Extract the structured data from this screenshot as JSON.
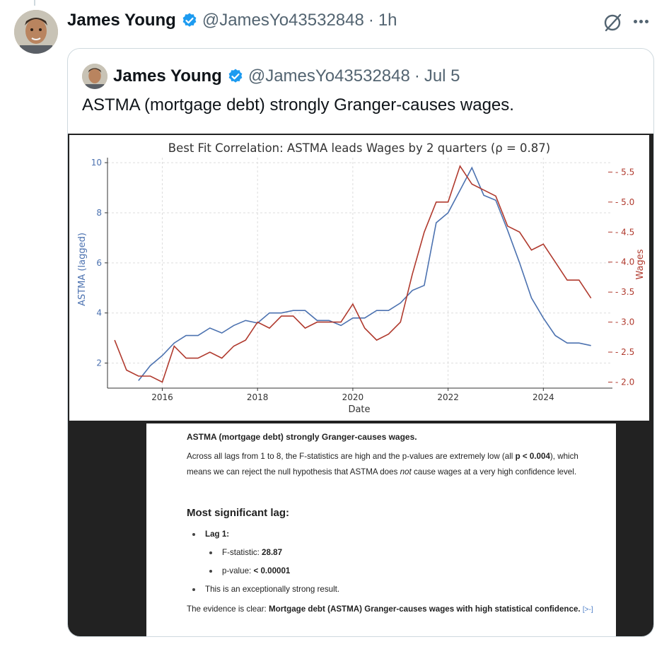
{
  "tweet": {
    "name": "James Young",
    "handle": "@JamesYo43532848",
    "separator": "·",
    "time": "1h"
  },
  "quoted_tweet": {
    "name": "James Young",
    "handle": "@JamesYo43532848",
    "separator": "·",
    "time": "Jul 5",
    "text": "ASTMA (mortgage debt) strongly Granger-causes wages."
  },
  "colors": {
    "verified": "#1d9bf0",
    "astma_series": "#4c72b0",
    "wages_series": "#b03a2e",
    "media_bg": "#222222"
  },
  "icons": {
    "verified": "verified-badge-icon",
    "grok": "grok-icon",
    "more": "more-icon"
  },
  "chart_data": {
    "type": "line",
    "title": "Best Fit Correlation: ASTMA leads Wages by 2 quarters (ρ = 0.87)",
    "xlabel": "Date",
    "ylabel_left": "ASTMA (lagged)",
    "ylabel_right": "Wages",
    "xlim": [
      2014.85,
      2025.45
    ],
    "ylim_left": [
      1.0,
      10.2
    ],
    "ylim_right": [
      1.9,
      5.74
    ],
    "x_ticks": [
      "2016",
      "2018",
      "2020",
      "2022",
      "2024"
    ],
    "y_ticks_left": [
      "2",
      "4",
      "6",
      "8",
      "10"
    ],
    "y_ticks_right": [
      "2.0",
      "2.5",
      "3.0",
      "3.5",
      "4.0",
      "4.5",
      "5.0",
      "5.5"
    ],
    "grid": true,
    "series": [
      {
        "name": "ASTMA (lagged)",
        "axis": "left",
        "x": [
          2015.5,
          2015.75,
          2016.0,
          2016.25,
          2016.5,
          2016.75,
          2017.0,
          2017.25,
          2017.5,
          2017.75,
          2018.0,
          2018.25,
          2018.5,
          2018.75,
          2019.0,
          2019.25,
          2019.5,
          2019.75,
          2020.0,
          2020.25,
          2020.5,
          2020.75,
          2021.0,
          2021.25,
          2021.5,
          2021.75,
          2022.0,
          2022.25,
          2022.5,
          2022.75,
          2023.0,
          2023.25,
          2023.5,
          2023.75,
          2024.0,
          2024.25,
          2024.5,
          2024.75,
          2025.0
        ],
        "values": [
          1.3,
          1.9,
          2.3,
          2.8,
          3.1,
          3.1,
          3.4,
          3.2,
          3.5,
          3.7,
          3.6,
          4.0,
          4.0,
          4.1,
          4.1,
          3.7,
          3.7,
          3.5,
          3.8,
          3.8,
          4.1,
          4.1,
          4.4,
          4.9,
          5.1,
          7.6,
          8.0,
          8.9,
          9.8,
          8.7,
          8.5,
          7.3,
          6.0,
          4.6,
          3.8,
          3.1,
          2.8,
          2.8,
          2.7
        ]
      },
      {
        "name": "Wages",
        "axis": "right",
        "x": [
          2015.0,
          2015.25,
          2015.5,
          2015.75,
          2016.0,
          2016.25,
          2016.5,
          2016.75,
          2017.0,
          2017.25,
          2017.5,
          2017.75,
          2018.0,
          2018.25,
          2018.5,
          2018.75,
          2019.0,
          2019.25,
          2019.5,
          2019.75,
          2020.0,
          2020.25,
          2020.5,
          2020.75,
          2021.0,
          2021.25,
          2021.5,
          2021.75,
          2022.0,
          2022.25,
          2022.5,
          2022.75,
          2023.0,
          2023.25,
          2023.5,
          2023.75,
          2024.0,
          2024.25,
          2024.5,
          2024.75,
          2025.0
        ],
        "values": [
          2.7,
          2.2,
          2.1,
          2.1,
          2.0,
          2.6,
          2.4,
          2.4,
          2.5,
          2.4,
          2.6,
          2.7,
          3.0,
          2.9,
          3.1,
          3.1,
          2.9,
          3.0,
          3.0,
          3.0,
          3.3,
          2.9,
          2.7,
          2.8,
          3.0,
          3.8,
          4.5,
          5.0,
          5.0,
          5.6,
          5.3,
          5.2,
          5.1,
          4.6,
          4.5,
          4.2,
          4.3,
          4.0,
          3.7,
          3.7,
          3.4
        ]
      }
    ]
  },
  "document": {
    "title": "ASTMA (mortgage debt) strongly Granger-causes wages.",
    "para_1": "Across all lags from 1 to 8, the F-statistics are high and the p-values are extremely low (all ",
    "para_1_bold": "p < 0.004",
    "para_2": "), which means we can reject the null hypothesis that ASTMA does ",
    "para_2_italic": "not",
    "para_3": " cause wages at a very high confidence level.",
    "heading": "Most significant lag:",
    "lag_label": "Lag 1:",
    "f_stat_label": "F-statistic: ",
    "f_stat_value": "28.87",
    "p_value_label": "p-value: ",
    "p_value_value": "< 0.00001",
    "strong_result": "This is an exceptionally strong result.",
    "final_1": "The evidence is clear: ",
    "final_bold": "Mortgage debt (ASTMA) Granger-causes wages with high statistical confidence.",
    "link_icon": "[>-]"
  }
}
